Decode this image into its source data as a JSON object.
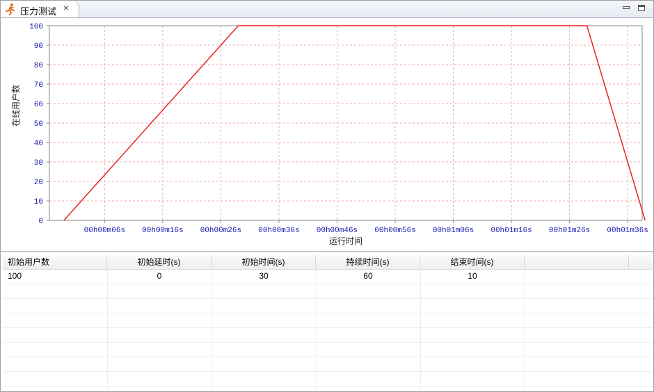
{
  "tab": {
    "title": "压力测试",
    "close_glyph": "⨯",
    "icon": "running-man-icon"
  },
  "window_controls": {
    "minimize_icon": "minimize-icon",
    "maximize_icon": "maximize-icon"
  },
  "colors": {
    "line": "#e8231f",
    "axis_text": "#1a1ab0",
    "grid": "#f2aaaa"
  },
  "chart_data": {
    "type": "line",
    "title": "",
    "xlabel": "运行时间",
    "ylabel": "在线用户数",
    "x_unit": "seconds",
    "xlim": [
      -3.5,
      98.5
    ],
    "ylim": [
      0,
      100
    ],
    "y_ticks": [
      0,
      10,
      20,
      30,
      40,
      50,
      60,
      70,
      80,
      90,
      100
    ],
    "x_ticks": [
      6,
      16,
      26,
      36,
      46,
      56,
      66,
      76,
      86,
      96
    ],
    "x_tick_labels": [
      "00h00m06s",
      "00h00m16s",
      "00h00m26s",
      "00h00m36s",
      "00h00m46s",
      "00h00m56s",
      "00h01m06s",
      "00h01m16s",
      "00h01m26s",
      "00h01m36s"
    ],
    "grid": true,
    "legend": "none",
    "series": [
      {
        "x": [
          -1,
          29,
          89,
          99
        ],
        "y": [
          0,
          100,
          100,
          0
        ]
      }
    ]
  },
  "table": {
    "columns": [
      "初始用户数",
      "初始延时(s)",
      "初始时间(s)",
      "持续时间(s)",
      "结束时间(s)",
      ""
    ],
    "rows": [
      [
        "100",
        "0",
        "30",
        "60",
        "10",
        ""
      ]
    ]
  }
}
